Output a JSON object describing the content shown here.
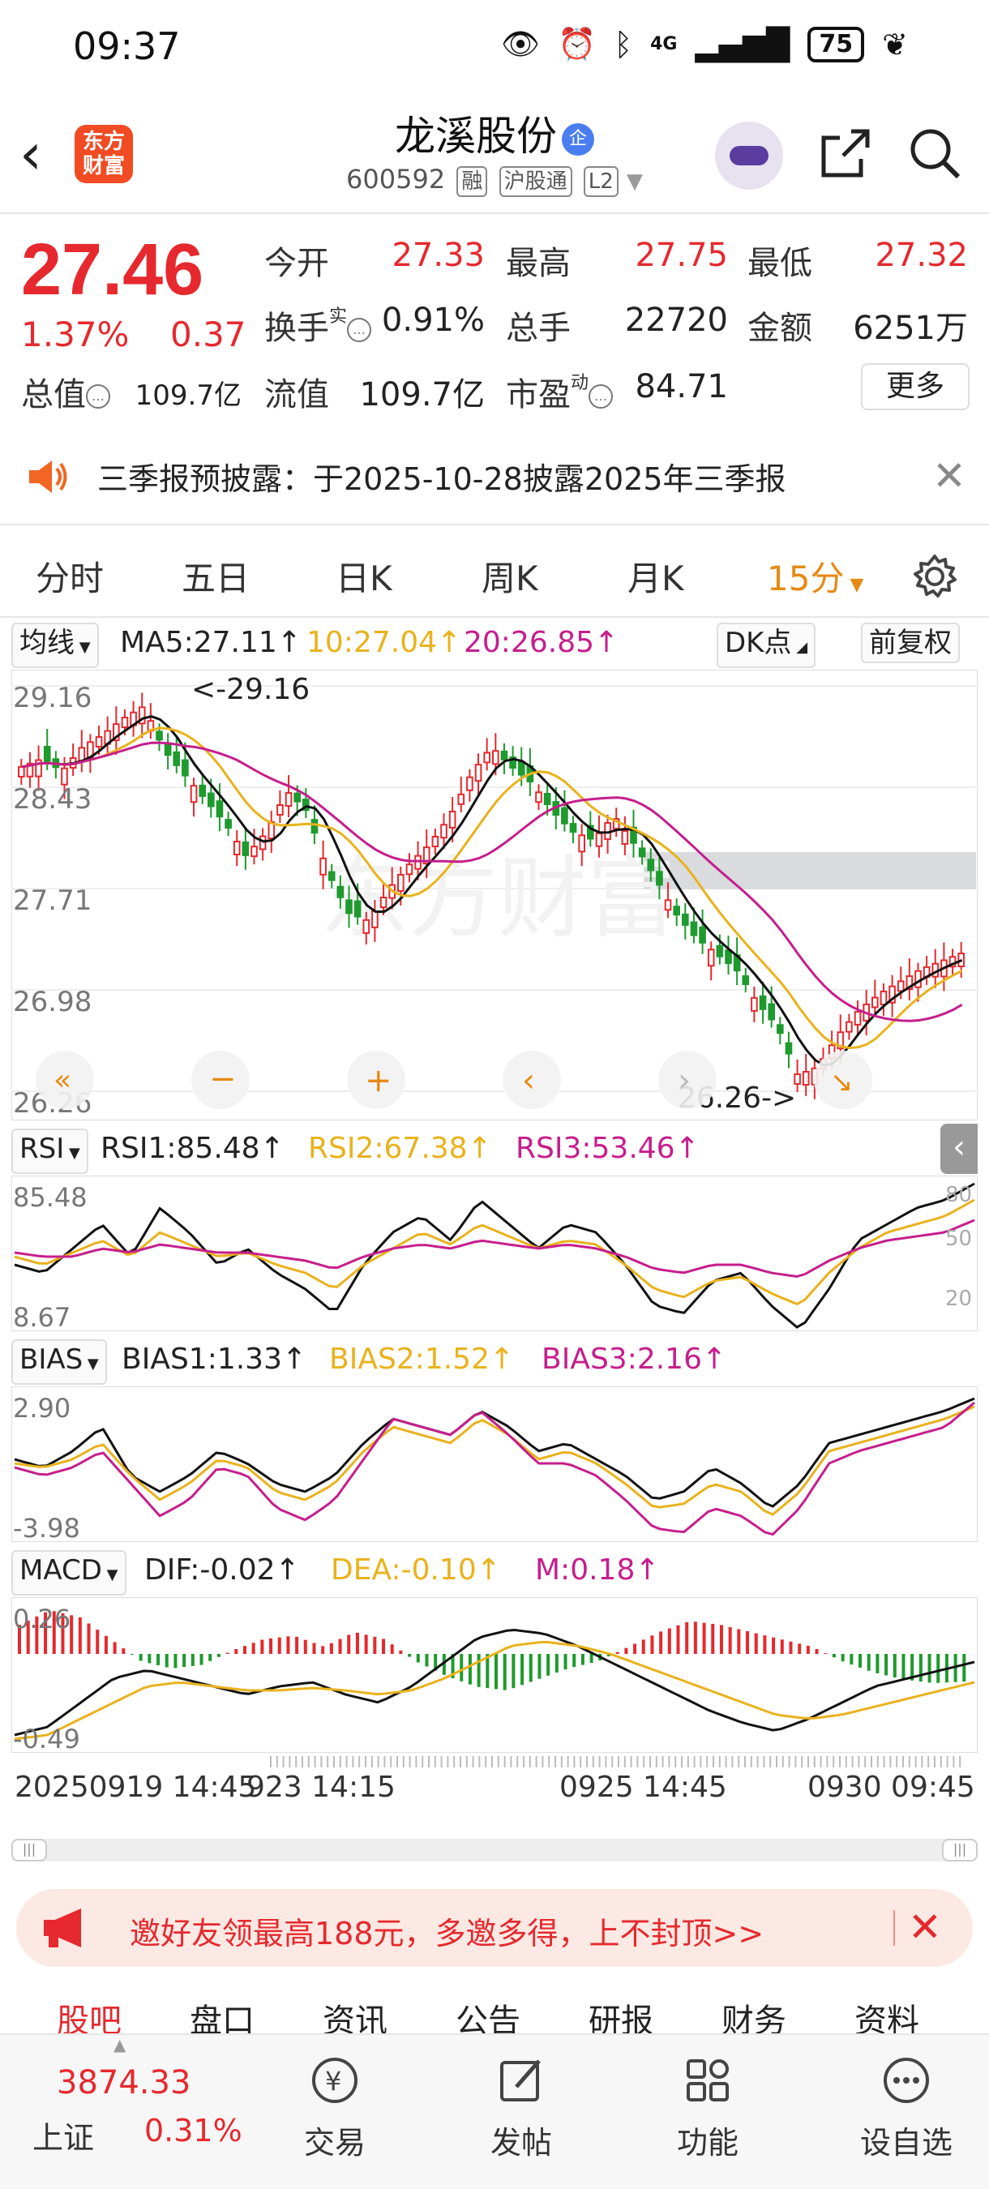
{
  "status_bar": {
    "time": "09:37",
    "battery": "75",
    "network": "4G"
  },
  "header": {
    "stock_name": "龙溪股份",
    "badge": "企",
    "logo_line1": "东方",
    "logo_line2": "财富",
    "code": "600592",
    "tags": [
      "融",
      "沪股通",
      "L2"
    ]
  },
  "quote": {
    "price": "27.46",
    "change_pct": "1.37%",
    "change": "0.37",
    "open_label": "今开",
    "open": "27.33",
    "high_label": "最高",
    "high": "27.75",
    "low_label": "最低",
    "low": "27.32",
    "turnover_label": "换手",
    "turnover_sup": "实",
    "turnover": "0.91%",
    "volume_label": "总手",
    "volume": "22720",
    "amount_label": "金额",
    "amount": "6251万",
    "mktcap_label": "总值",
    "mktcap": "109.7亿",
    "float_label": "流值",
    "float": "109.7亿",
    "pe_label": "市盈",
    "pe_sup": "动",
    "pe": "84.71",
    "more": "更多"
  },
  "notice": {
    "text": "三季报预披露：于2025-10-28披露2025年三季报"
  },
  "tabs": [
    "分时",
    "五日",
    "日K",
    "周K",
    "月K",
    "15分"
  ],
  "chart_header": {
    "ma_select": "均线",
    "ma5": "MA5:27.11↑",
    "ma10": "10:27.04↑",
    "ma20": "20:26.85↑",
    "dk": "DK点",
    "adjust": "前复权"
  },
  "main_chart": {
    "y_labels": [
      "29.16",
      "28.43",
      "27.71",
      "26.98",
      "26.26"
    ],
    "high_mark": "<-29.16",
    "low_mark": "26.26->"
  },
  "rsi": {
    "select": "RSI",
    "rsi1": "RSI1:85.48↑",
    "rsi2": "RSI2:67.38↑",
    "rsi3": "RSI3:53.46↑",
    "y_top": "85.48",
    "y_bottom": "8.67",
    "right_labels": [
      "80",
      "50",
      "20"
    ]
  },
  "bias": {
    "select": "BIAS",
    "b1": "BIAS1:1.33↑",
    "b2": "BIAS2:1.52↑",
    "b3": "BIAS3:2.16↑",
    "y_top": "2.90",
    "y_bottom": "-3.98"
  },
  "macd": {
    "select": "MACD",
    "dif": "DIF:-0.02↑",
    "dea": "DEA:-0.10↑",
    "m": "M:0.18↑",
    "y_top": "0.26",
    "y_bottom": "-0.49"
  },
  "time_axis": [
    "20250919 14:45",
    "923 14:15",
    "0925 14:45",
    "0930 09:45"
  ],
  "promo": {
    "text": "邀好友领最高188元，多邀多得，上不封顶>>"
  },
  "sub_tabs": [
    "股吧",
    "盘口",
    "资讯",
    "公告",
    "研报",
    "财务",
    "资料"
  ],
  "bottom_bar": {
    "index_value": "3874.33",
    "index_name": "上证",
    "index_pct": "0.31%",
    "items": [
      "交易",
      "发帖",
      "功能",
      "设自选"
    ]
  },
  "colors": {
    "up": "#e5292e",
    "down": "#1e9a2e",
    "accent": "#e58a14",
    "ma10": "#e9b21c",
    "ma20": "#c61e8c"
  }
}
